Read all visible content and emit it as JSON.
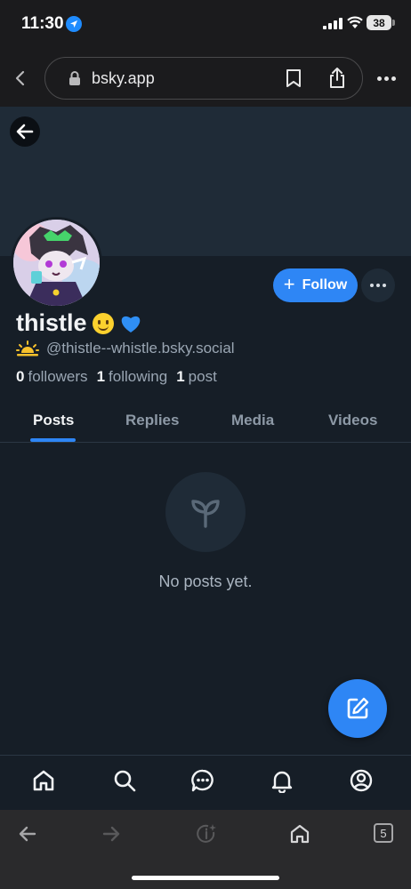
{
  "status_bar": {
    "time": "11:30",
    "battery": "38"
  },
  "browser": {
    "url": "bsky.app"
  },
  "profile": {
    "display_name": "thistle",
    "handle": "@thistle--whistle.bsky.social",
    "follow_label": "Follow",
    "stats": {
      "followers_count": "0",
      "followers_label": "followers",
      "following_count": "1",
      "following_label": "following",
      "posts_count": "1",
      "posts_label": "post"
    }
  },
  "tabs": [
    {
      "label": "Posts",
      "active": true
    },
    {
      "label": "Replies",
      "active": false
    },
    {
      "label": "Media",
      "active": false
    },
    {
      "label": "Videos",
      "active": false
    }
  ],
  "feed": {
    "empty_message": "No posts yet."
  },
  "bottom_nav": {
    "items": [
      "home-icon",
      "search-icon",
      "chat-icon",
      "notifications-icon",
      "profile-icon"
    ]
  },
  "safari_toolbar": {
    "tab_count": "5"
  },
  "colors": {
    "background": "#161e27",
    "accent": "#2e86f5",
    "banner": "#1f2b37"
  }
}
